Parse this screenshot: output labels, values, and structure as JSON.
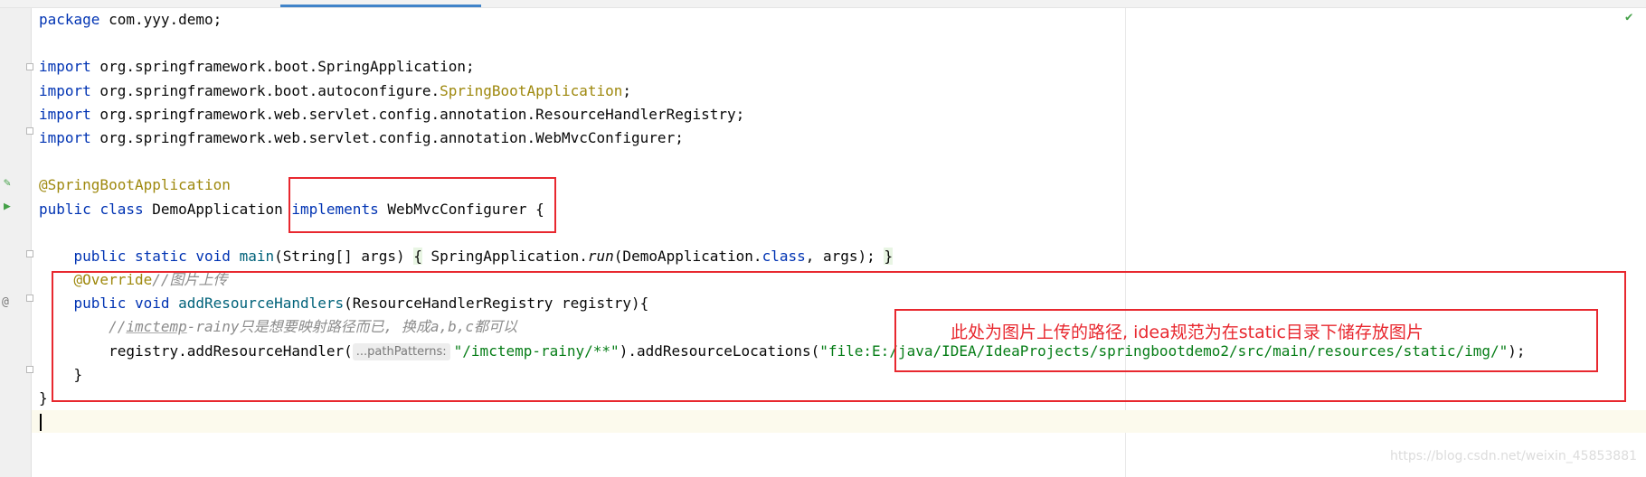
{
  "code": {
    "package_kw": "package",
    "package_name": " com.yyy.demo;",
    "imports": [
      {
        "kw": "import",
        "path": " org.springframework.boot.SpringApplication;",
        "extra": ""
      },
      {
        "kw": "import",
        "path": " org.springframework.boot.autoconfigure.",
        "extra": "SpringBootApplication"
      },
      {
        "kw": "import",
        "path": " org.springframework.web.servlet.config.annotation.ResourceHandlerRegistry;",
        "extra": ""
      },
      {
        "kw": "import",
        "path": " org.springframework.web.servlet.config.annotation.WebMvcConfigurer;",
        "extra": ""
      }
    ],
    "import_semicolon": ";",
    "annotation": "@SpringBootApplication",
    "class_line": {
      "public": "public",
      "class": "class",
      "name": " DemoApplication ",
      "implements": "implements",
      "iface": " WebMvcConfigurer ",
      "brace": "{"
    },
    "main_line": {
      "mods": "public static void ",
      "name": "main",
      "params": "(String[] args) ",
      "open": "{",
      "body": " SpringApplication.",
      "run": "run",
      "args1": "(DemoApplication.",
      "class_kw": "class",
      "args2": ", args); ",
      "close": "}"
    },
    "override": "@Override",
    "override_comment": "//图片上传",
    "handler_sig": {
      "mods": "public void ",
      "name": "addResourceHandlers",
      "params": "(ResourceHandlerRegistry registry){"
    },
    "inner_comment_prefix": "//",
    "inner_comment_word": "imctemp",
    "inner_comment_rest": "-rainy只是想要映射路径而已, 换成a,b,c都可以",
    "registry_call": "registry.addResourceHandler(",
    "hint": "...pathPatterns:",
    "handler_string": "\"/imctemp-rainy/**\"",
    "locations_call": ").addResourceLocations(",
    "locations_string": "\"file:E:/java/IDEA/IdeaProjects/springbootdemo2/src/main/resources/static/img/\"",
    "locations_end": ");",
    "method_close": "}",
    "class_close": "}"
  },
  "annotation_note": "此处为图片上传的路径, idea规范为在static目录下储存放图片",
  "watermark": "https://blog.csdn.net/weixin_45853881",
  "colors": {
    "keyword": "#0033b3",
    "annotation": "#9e880d",
    "string": "#067d17",
    "comment": "#8c8c8c",
    "highlight_box": "#e8282f"
  }
}
